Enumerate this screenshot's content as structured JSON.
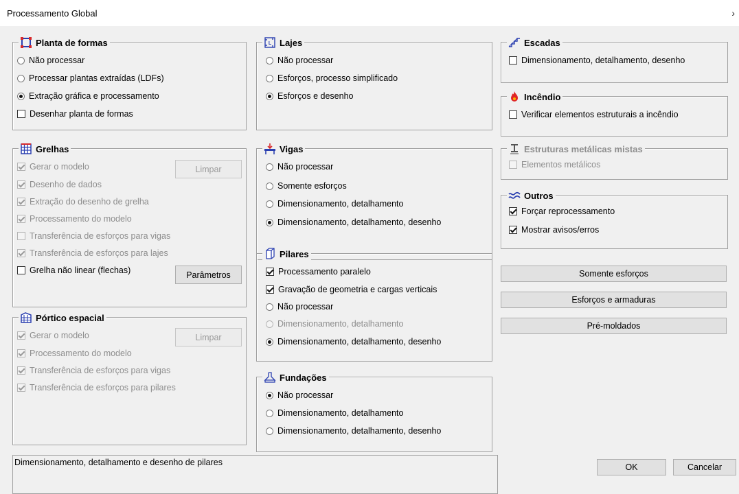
{
  "window": {
    "title": "Processamento Global",
    "chevron": "›"
  },
  "planta": {
    "title": "Planta de formas",
    "icon": "floor-plan-icon",
    "options": [
      "Não processar",
      "Processar plantas extraídas (LDFs)",
      "Extração gráfica e processamento"
    ],
    "selected": 2,
    "checkbox": {
      "label": "Desenhar planta de formas",
      "checked": false
    }
  },
  "grelhas": {
    "title": "Grelhas",
    "icon": "grid-icon",
    "items": [
      {
        "label": "Gerar o modelo",
        "checked": true,
        "enabled": false
      },
      {
        "label": "Desenho de dados",
        "checked": true,
        "enabled": false
      },
      {
        "label": "Extração do desenho de grelha",
        "checked": true,
        "enabled": false
      },
      {
        "label": "Processamento do modelo",
        "checked": true,
        "enabled": false
      },
      {
        "label": "Transferência de esforços para vigas",
        "checked": false,
        "enabled": false
      },
      {
        "label": "Transferência de esforços para lajes",
        "checked": true,
        "enabled": false
      },
      {
        "label": "Grelha não linear (flechas)",
        "checked": false,
        "enabled": true
      }
    ],
    "limpar": "Limpar",
    "parametros": "Parâmetros"
  },
  "portico": {
    "title": "Pórtico espacial",
    "icon": "frame-building-icon",
    "items": [
      {
        "label": "Gerar o modelo",
        "checked": true
      },
      {
        "label": "Processamento do modelo",
        "checked": true
      },
      {
        "label": "Transferência de esforços para vigas",
        "checked": true
      },
      {
        "label": "Transferência de esforços para pilares",
        "checked": true
      }
    ],
    "limpar": "Limpar"
  },
  "lajes": {
    "title": "Lajes",
    "icon": "slab-icon",
    "options": [
      "Não processar",
      "Esforços, processo simplificado",
      "Esforços e desenho"
    ],
    "selected": 2
  },
  "vigas": {
    "title": "Vigas",
    "icon": "beam-icon",
    "options": [
      "Não processar",
      "Somente esforços",
      "Dimensionamento, detalhamento",
      "Dimensionamento, detalhamento, desenho"
    ],
    "selected": 3
  },
  "pilares": {
    "title": "Pilares",
    "icon": "column-icon",
    "checks": [
      {
        "label": "Processamento paralelo",
        "checked": true
      },
      {
        "label": "Gravação de geometria e cargas verticais",
        "checked": true
      }
    ],
    "options": [
      {
        "label": "Não processar",
        "enabled": true
      },
      {
        "label": "Dimensionamento, detalhamento",
        "enabled": false
      },
      {
        "label": "Dimensionamento, detalhamento, desenho",
        "enabled": true
      }
    ],
    "selected": 2
  },
  "fundacoes": {
    "title": "Fundações",
    "icon": "foundation-icon",
    "options": [
      "Não processar",
      "Dimensionamento, detalhamento",
      "Dimensionamento, detalhamento, desenho"
    ],
    "selected": 0
  },
  "escadas": {
    "title": "Escadas",
    "icon": "stairs-icon",
    "checkbox": {
      "label": "Dimensionamento, detalhamento, desenho",
      "checked": false
    }
  },
  "incendio": {
    "title": "Incêndio",
    "icon": "fire-icon",
    "checkbox": {
      "label": "Verificar elementos estruturais a incêndio",
      "checked": false
    }
  },
  "metalicas": {
    "title": "Estruturas metálicas mistas",
    "icon": "steel-beam-icon",
    "checkbox": {
      "label": "Elementos metálicos",
      "checked": false
    }
  },
  "outros": {
    "title": "Outros",
    "icon": "waves-icon",
    "items": [
      {
        "label": "Forçar reprocessamento",
        "checked": true
      },
      {
        "label": "Mostrar avisos/erros",
        "checked": true
      }
    ]
  },
  "actions": {
    "somente": "Somente esforços",
    "esforcos_armaduras": "Esforços e armaduras",
    "premoldados": "Pré-moldados"
  },
  "status": "Dimensionamento, detalhamento e desenho de pilares",
  "footer": {
    "ok": "OK",
    "cancel": "Cancelar"
  }
}
